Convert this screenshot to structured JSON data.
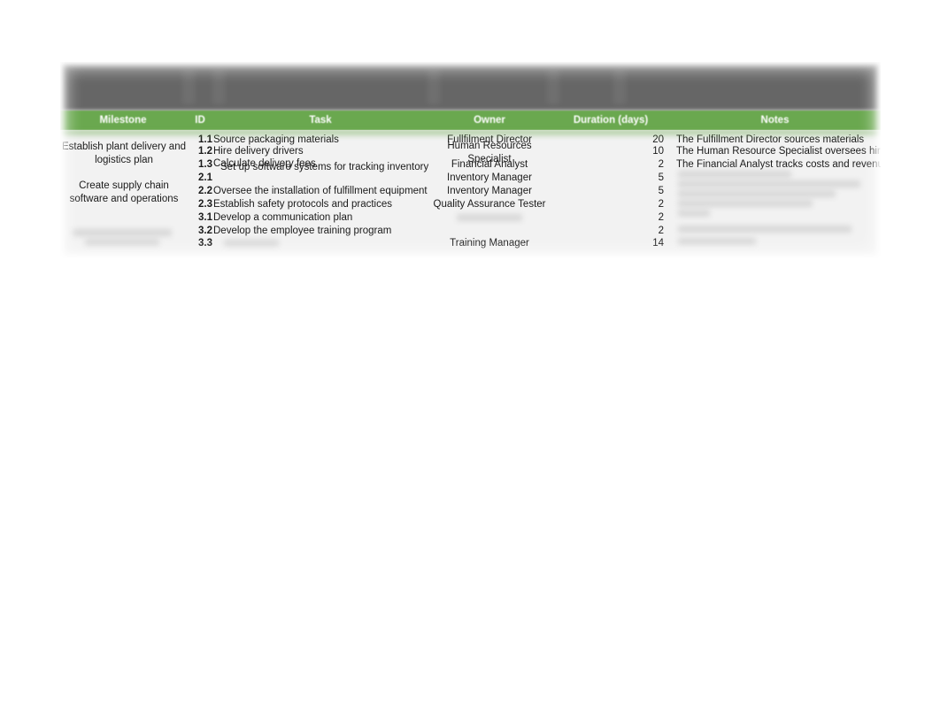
{
  "document": {
    "type": "project-plan-spreadsheet",
    "colors": {
      "header_green": "#6aa84f",
      "toolbar_gray": "#666666",
      "body_background": "#f2f2f2",
      "page_background": "#ffffff",
      "text": "#1a1a1a",
      "header_text": "#ffffff"
    }
  },
  "table": {
    "headers": {
      "milestone": "Milestone",
      "id": "ID",
      "task": "Task",
      "owner": "Owner",
      "duration": "Duration (days)",
      "notes": "Notes"
    },
    "milestones": [
      {
        "label": "Establish plant delivery and logistics plan",
        "legible": true
      },
      {
        "label": "Create supply chain software and operations",
        "legible": true
      },
      {
        "label": "",
        "legible": false
      }
    ],
    "rows": [
      {
        "id": "1.1",
        "task": "Source packaging materials",
        "owner": "Fullfilment Director",
        "duration": "20",
        "notes": "The Fulfillment Director sources materials"
      },
      {
        "id": "1.2",
        "task": "Hire delivery drivers",
        "owner": "Human Resources Specialist",
        "duration": "10",
        "notes": "The Human Resource Specialist oversees hiring"
      },
      {
        "id": "1.3",
        "task": "Calculate delivery fees",
        "owner": "Financial Analyst",
        "duration": "2",
        "notes": "The Financial Analyst tracks costs and revenue"
      },
      {
        "id": "2.1",
        "task": "Set up software systems for tracking inventory",
        "owner": "Inventory Manager",
        "duration": "5",
        "notes": ""
      },
      {
        "id": "2.2",
        "task": "Oversee the installation of fulfillment equipment",
        "owner": "Inventory Manager",
        "duration": "5",
        "notes": ""
      },
      {
        "id": "2.3",
        "task": "Establish safety protocols and practices",
        "owner": "Quality Assurance Tester",
        "duration": "2",
        "notes": ""
      },
      {
        "id": "3.1",
        "task": "Develop a communication plan",
        "owner": "",
        "duration": "2",
        "notes": ""
      },
      {
        "id": "3.2",
        "task": "Develop the employee training program",
        "owner": "",
        "duration": "2",
        "notes": ""
      },
      {
        "id": "3.3",
        "task": "",
        "owner": "Training Manager",
        "duration": "14",
        "notes": ""
      }
    ]
  }
}
